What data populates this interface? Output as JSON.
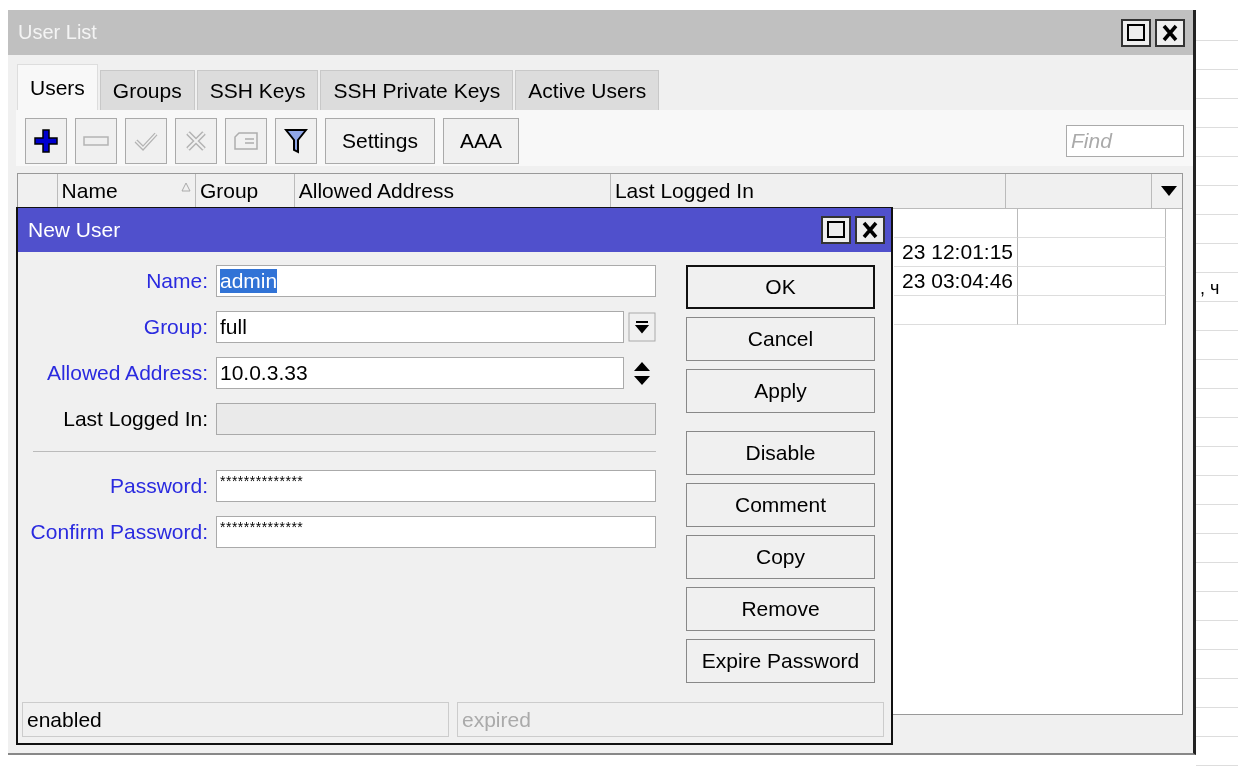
{
  "window": {
    "title": "User List"
  },
  "tabs": [
    {
      "label": "Users",
      "selected": true
    },
    {
      "label": "Groups",
      "selected": false
    },
    {
      "label": "SSH Keys",
      "selected": false
    },
    {
      "label": "SSH Private Keys",
      "selected": false
    },
    {
      "label": "Active Users",
      "selected": false
    }
  ],
  "toolbar": [
    {
      "kind": "icon",
      "disabled": false
    },
    {
      "kind": "icon",
      "disabled": true
    },
    {
      "kind": "icon",
      "disabled": true
    },
    {
      "kind": "icon",
      "disabled": true
    },
    {
      "kind": "icon",
      "disabled": true
    },
    {
      "kind": "icon",
      "disabled": false
    },
    {
      "kind": "text",
      "label": "Settings",
      "disabled": false
    },
    {
      "kind": "text",
      "label": "AAA",
      "disabled": false
    }
  ],
  "search": {
    "placeholder": "Find"
  },
  "table": {
    "columns": [
      {
        "label": "Name",
        "sorted": true
      },
      {
        "label": "Group",
        "sorted": false
      },
      {
        "label": "Allowed Address",
        "sorted": false
      },
      {
        "label": "Last Logged In",
        "sorted": false
      }
    ],
    "rows": [
      {
        "last_logged_in": "23 12:01:15"
      },
      {
        "last_logged_in": "23 03:04:46"
      }
    ]
  },
  "background_text": ", ч",
  "dialog": {
    "title": "New User",
    "fields": [
      {
        "label": "Name:",
        "value": "admin",
        "kind": "text",
        "highlighted": true,
        "disabled": false,
        "value_selected": true
      },
      {
        "label": "Group:",
        "value": "full",
        "kind": "dropdown",
        "highlighted": true,
        "disabled": false,
        "value_selected": false
      },
      {
        "label": "Allowed Address:",
        "value": "10.0.3.33",
        "kind": "spinner",
        "highlighted": true,
        "disabled": false,
        "value_selected": false
      },
      {
        "label": "Last Logged In:",
        "kind": "text",
        "highlighted": false,
        "disabled": true
      }
    ],
    "password_fields": [
      {
        "label": "Password:",
        "value": "**************",
        "highlighted": true
      },
      {
        "label": "Confirm Password:",
        "value": "**************",
        "highlighted": true
      }
    ],
    "button_groups": [
      [
        {
          "label": "OK",
          "default": true
        },
        {
          "label": "Cancel",
          "default": false
        },
        {
          "label": "Apply",
          "default": false
        }
      ],
      [
        {
          "label": "Disable",
          "default": false
        },
        {
          "label": "Comment",
          "default": false
        },
        {
          "label": "Copy",
          "default": false
        },
        {
          "label": "Remove",
          "default": false
        },
        {
          "label": "Expire Password",
          "default": false
        }
      ]
    ],
    "status": [
      {
        "text": "enabled",
        "disabled": false
      },
      {
        "text": "expired",
        "disabled": true
      }
    ]
  }
}
